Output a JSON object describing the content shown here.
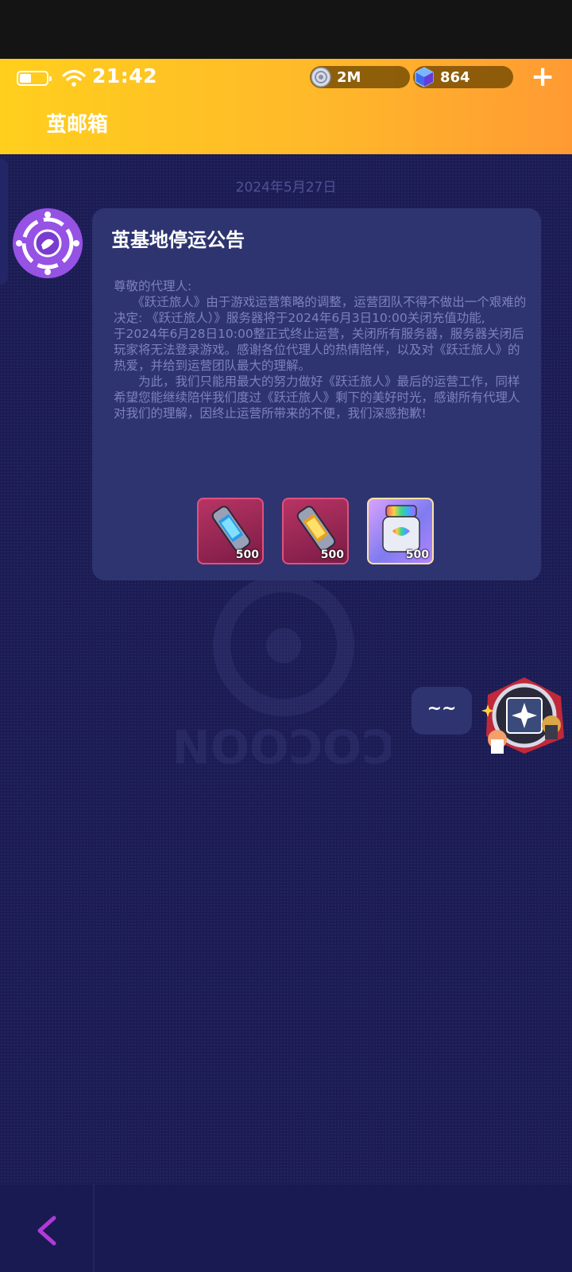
{
  "status_bar": {
    "time": "21:42",
    "battery_level": 0.45
  },
  "currency": {
    "coin": {
      "icon": "coin-disc-icon",
      "value": "2M"
    },
    "gem": {
      "icon": "gem-cube-icon",
      "value": "864"
    },
    "add_label": "+"
  },
  "header": {
    "title": "茧邮箱"
  },
  "thread": {
    "date": "2024年5月27日",
    "message": {
      "title": "茧基地停运公告",
      "body": "尊敬的代理人:\n　　《跃迁旅人》由于游戏运营策略的调整，运营团队不得不做出一个艰难的决定: 《跃迁旅人）》服务器将于2024年6月3日10:00关闭充值功能,\n于2024年6月28日10:00整正式终止运营，关闭所有服务器，服务器关闭后玩家将无法登录游戏。感谢各位代理人的热情陪伴，以及对《跃迁旅人》的热爱，并给到运营团队最大的理解。\n　　为此，我们只能用最大的努力做好《跃迁旅人》最后的运营工作，同样希望您能继续陪伴我们度过《跃迁旅人》剩下的美好时光，感谢所有代理人对我们的理解，因终止运营所带来的不便，我们深感抱歉!",
      "rewards": [
        {
          "icon": "blue-canister-icon",
          "qty": "500"
        },
        {
          "icon": "gold-canister-icon",
          "qty": "500"
        },
        {
          "icon": "rainbow-jar-icon",
          "qty": "500"
        }
      ]
    },
    "reply": {
      "text": "~~"
    }
  },
  "colors": {
    "header_start": "#ffcf1d",
    "header_end": "#ff9a33",
    "background": "#1c1c55",
    "card": "#2e3470",
    "back_arrow": "#b03ad8"
  }
}
